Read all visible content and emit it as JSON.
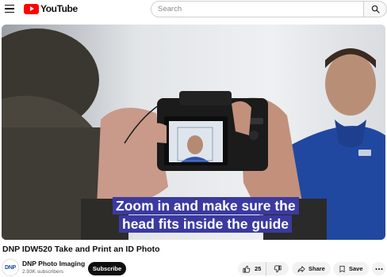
{
  "header": {
    "logo_text": "YouTube",
    "search_placeholder": "Search",
    "icons": {
      "menu": "hamburger-menu-icon",
      "search": "search-icon",
      "logo": "youtube-play-logo"
    }
  },
  "video": {
    "caption_line1": "Zoom in and make sure the",
    "caption_line2": "head fits inside the guide",
    "caption_bg": "#3a3aa0",
    "title": "DNP IDW520 Take and Print an ID Photo"
  },
  "channel": {
    "avatar_text": "DNP",
    "name": "DNP Photo Imaging",
    "subscribers": "2.93K subscribers",
    "subscribe_label": "Subscribe"
  },
  "actions": {
    "like_count": "25",
    "share_label": "Share",
    "save_label": "Save",
    "icons": {
      "like": "thumbs-up-icon",
      "dislike": "thumbs-down-icon",
      "share": "share-arrow-icon",
      "save": "bookmark-icon",
      "more": "more-dots-icon"
    }
  },
  "colors": {
    "brand_red": "#ff0000",
    "subscribe_bg": "#0f0f0f",
    "pill_bg": "#f2f2f2"
  }
}
